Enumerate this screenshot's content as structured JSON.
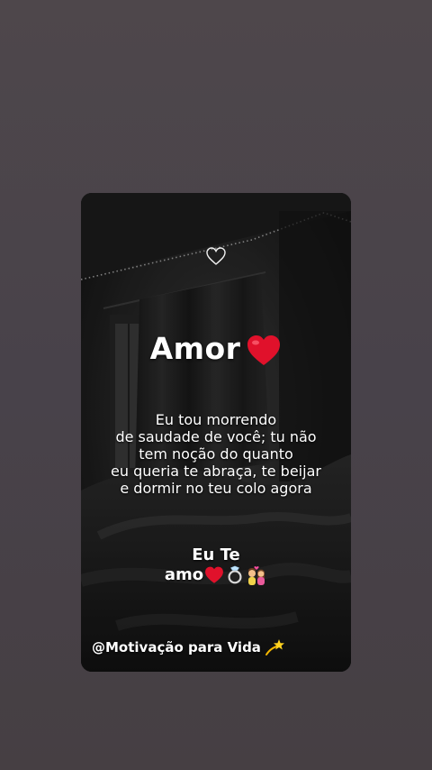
{
  "story": {
    "title": "Amor",
    "title_emoji": "heart-icon",
    "message": "Eu tou morrendo\nde saudade de você; tu não\ntem noção do quanto\neu queria te abraça, te beijar\ne dormir no teu colo agora",
    "love_line1": "Eu Te",
    "love_line2": "amo",
    "love_emojis": [
      "heart-icon",
      "ring-icon",
      "couple-icon"
    ],
    "footer_handle": "@Motivação para Vida",
    "footer_emoji": "dizzy-star-icon"
  },
  "colors": {
    "page_background": "#4a4347",
    "card_background": "#141414",
    "heart_red": "#e0112b",
    "text": "#ffffff"
  }
}
